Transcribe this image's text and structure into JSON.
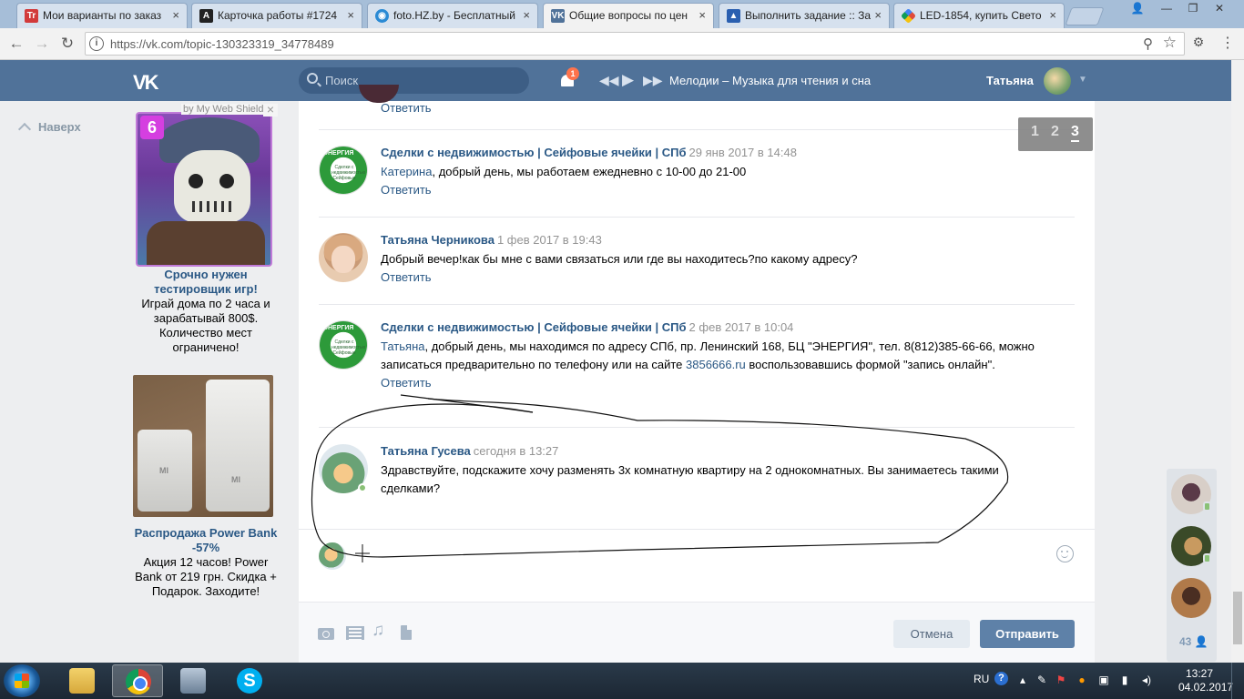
{
  "browser": {
    "tabs": [
      {
        "title": "Мои варианты по заказ",
        "favicon": "tz-icon",
        "color": "#d23a3a"
      },
      {
        "title": "Карточка работы #1724",
        "favicon": "a-icon",
        "color": "#222222"
      },
      {
        "title": "foto.HZ.by - Бесплатный",
        "favicon": "foto-icon",
        "color": "#2a8ad4"
      },
      {
        "title": "Общие вопросы по цен",
        "favicon": "vk-icon",
        "color": "#507299"
      },
      {
        "title": "Выполнить задание :: За",
        "favicon": "triangle-icon",
        "color": "#2a5fb0"
      },
      {
        "title": "LED-1854, купить Свето",
        "favicon": "google-icon",
        "color": "#e04a3a"
      }
    ],
    "url": "https://vk.com/topic-130323319_34778489"
  },
  "header": {
    "logo": "VK",
    "search_placeholder": "Поиск",
    "notifications_count": "1",
    "track": "Мелодии – Музыка для чтения и сна",
    "user_name": "Татьяна"
  },
  "sidebar": {
    "back_label": "Наверх"
  },
  "ads": {
    "shield_label": "by My Web Shield",
    "ad1": {
      "badge": "6",
      "title": "Срочно нужен тестировщик игр!",
      "text": "Играй дома по 2 часа и зарабатывай 800$. Количество мест ограничено!"
    },
    "ad2": {
      "title": "Распродажа Power Bank -57%",
      "text": "Акция 12 часов! Power Bank от 219 грн. Скидка + Подарок. Заходите!",
      "brand": "MI"
    }
  },
  "pagination": {
    "pages": [
      "1",
      "2",
      "3"
    ],
    "current": "3"
  },
  "posts": [
    {
      "reply": "Ответить"
    },
    {
      "author": "Сделки с недвижимостью | Сейфовые ячейки | СПб",
      "date": "29 янв 2017 в 14:48",
      "mention": "Катерина",
      "text": ", добрый день, мы работаем ежедневно с 10-00 до 21-00",
      "reply": "Ответить"
    },
    {
      "author": "Татьяна Черникова",
      "date": "1 фев 2017 в 19:43",
      "text": "Добрый вечер!как бы мне с вами связаться или где вы находитесь?по какому адресу?",
      "reply": "Ответить"
    },
    {
      "author": "Сделки с недвижимостью | Сейфовые ячейки | СПб",
      "date": "2 фев 2017 в 10:04",
      "mention": "Татьяна",
      "text_a": ", добрый день, мы находимся по адресу СПб, пр. Ленинский 168, БЦ \"ЭНЕРГИЯ\", тел. 8(812)385-66-66, можно записаться предварительно по телефону или на сайте ",
      "link": "3856666.ru",
      "text_b": " воспользовавшись формой \"запись онлайн\".",
      "reply": "Ответить"
    },
    {
      "author": "Татьяна Гусева",
      "date": "сегодня в 13:27",
      "text": "Здравствуйте, подскажите хочу разменять 3х комнатную квартиру на 2 однокомнатных. Вы занимаетесь такими сделками?"
    }
  ],
  "energy_logo": {
    "brand": "ЭНЕРГИЯ",
    "lines": "Сделки с недвижимостью Сейфовые"
  },
  "composer": {
    "cancel_label": "Отмена",
    "send_label": "Отправить"
  },
  "friends": {
    "count": "43"
  },
  "taskbar": {
    "lang": "RU",
    "time": "13:27",
    "date": "04.02.2017"
  }
}
